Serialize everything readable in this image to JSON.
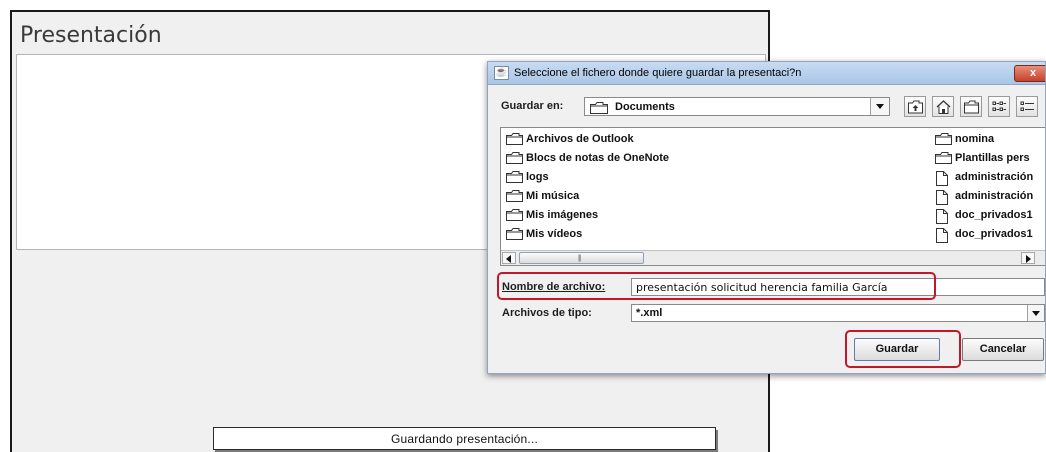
{
  "main": {
    "title": "Presentación",
    "progress_text": "Guardando presentación..."
  },
  "dialog": {
    "title": "Seleccione el fichero donde quiere guardar la presentaci?n",
    "close_label": "x",
    "look_in_label": "Guardar en:",
    "look_in_value": "Documents",
    "files": [
      {
        "name": "Archivos de Outlook",
        "type": "folder"
      },
      {
        "name": "Blocs de notas de OneNote",
        "type": "folder"
      },
      {
        "name": "logs",
        "type": "folder"
      },
      {
        "name": "Mi música",
        "type": "folder"
      },
      {
        "name": "Mis imágenes",
        "type": "folder"
      },
      {
        "name": "Mis vídeos",
        "type": "folder"
      },
      {
        "name": "nomina",
        "type": "folder"
      },
      {
        "name": "Plantillas pers",
        "type": "folder"
      },
      {
        "name": "administración",
        "type": "file"
      },
      {
        "name": "administración",
        "type": "file"
      },
      {
        "name": "doc_privados1",
        "type": "file"
      },
      {
        "name": "doc_privados1",
        "type": "file"
      }
    ],
    "filename_label": "Nombre de archivo:",
    "filename_value": "presentación solicitud herencia familia García",
    "filetype_label": "Archivos de tipo:",
    "filetype_value": "*.xml",
    "save_label": "Guardar",
    "cancel_label": "Cancelar"
  },
  "colors": {
    "highlight": "#c0182b",
    "titlebar": "#b6cfec"
  }
}
